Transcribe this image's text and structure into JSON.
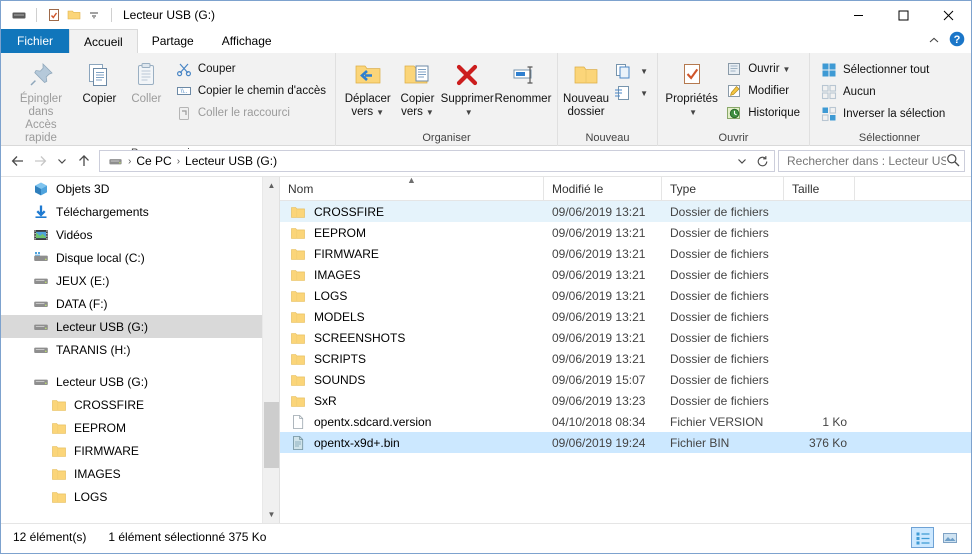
{
  "window": {
    "title": "Lecteur USB (G:)",
    "accent": "#1176bb",
    "selection_color": "#cce8ff",
    "hover_color": "#e5f3fb"
  },
  "quick_access": [
    {
      "name": "properties-qat",
      "icon": "properties-icon"
    },
    {
      "name": "new-folder-qat",
      "icon": "folder-icon"
    },
    {
      "name": "customize-qat",
      "icon": "chevron-down-icon"
    }
  ],
  "window_controls": {
    "minimize": "—",
    "maximize": "□",
    "close": "✕",
    "collapse_ribbon": "˄",
    "help": "?"
  },
  "tabs": [
    {
      "label": "Fichier",
      "kind": "file"
    },
    {
      "label": "Accueil",
      "kind": "active"
    },
    {
      "label": "Partage",
      "kind": "normal"
    },
    {
      "label": "Affichage",
      "kind": "normal"
    }
  ],
  "ribbon": {
    "groups": [
      {
        "label": "Presse-papiers",
        "big": [
          {
            "label_line1": "Épingler dans",
            "label_line2": "Accès rapide",
            "icon": "pin-icon",
            "disabled": false
          },
          {
            "label_line1": "Copier",
            "label_line2": "",
            "icon": "copy-icon",
            "disabled": false
          },
          {
            "label_line1": "Coller",
            "label_line2": "",
            "icon": "paste-icon",
            "disabled": true
          }
        ],
        "small": [
          {
            "label": "Couper",
            "icon": "scissors-icon",
            "disabled": false
          },
          {
            "label": "Copier le chemin d'accès",
            "icon": "copy-path-icon",
            "disabled": false
          },
          {
            "label": "Coller le raccourci",
            "icon": "paste-shortcut-icon",
            "disabled": true
          }
        ]
      },
      {
        "label": "Organiser",
        "big": [
          {
            "label_line1": "Déplacer",
            "label_line2": "vers",
            "icon": "move-to-icon",
            "dropdown": true
          },
          {
            "label_line1": "Copier",
            "label_line2": "vers",
            "icon": "copy-to-icon",
            "dropdown": true
          },
          {
            "label_line1": "Supprimer",
            "label_line2": "",
            "icon": "delete-icon",
            "dropdown": true
          },
          {
            "label_line1": "Renommer",
            "label_line2": "",
            "icon": "rename-icon",
            "dropdown": false
          }
        ],
        "small": []
      },
      {
        "label": "Nouveau",
        "big": [
          {
            "label_line1": "Nouveau",
            "label_line2": "dossier",
            "icon": "new-folder-icon",
            "dropdown": false
          }
        ],
        "small": [
          {
            "label": "",
            "icon": "new-item-icon",
            "dropdown": true
          },
          {
            "label": "",
            "icon": "easy-access-icon",
            "dropdown": true
          }
        ]
      },
      {
        "label": "Ouvrir",
        "big": [
          {
            "label_line1": "Propriétés",
            "label_line2": "",
            "icon": "properties-icon",
            "dropdown": true
          }
        ],
        "small": [
          {
            "label": "Ouvrir",
            "icon": "open-with-icon",
            "dropdown": true
          },
          {
            "label": "Modifier",
            "icon": "edit-icon",
            "dropdown": false
          },
          {
            "label": "Historique",
            "icon": "history-icon",
            "dropdown": false
          }
        ]
      },
      {
        "label": "Sélectionner",
        "big": [],
        "small": [
          {
            "label": "Sélectionner tout",
            "icon": "select-all-icon",
            "dropdown": false
          },
          {
            "label": "Aucun",
            "icon": "select-none-icon",
            "dropdown": false
          },
          {
            "label": "Inverser la sélection",
            "icon": "invert-selection-icon",
            "dropdown": false
          }
        ]
      }
    ]
  },
  "address": {
    "back_icon": "arrow-left-icon",
    "forward_icon": "arrow-right-icon",
    "recent_icon": "chevron-down-icon",
    "up_icon": "arrow-up-icon",
    "drive_icon": "drive-icon",
    "crumbs": [
      "Ce PC",
      "Lecteur USB (G:)"
    ],
    "separator": "›",
    "dropdown_icon": "chevron-down-icon",
    "refresh_icon": "refresh-icon"
  },
  "search": {
    "placeholder": "Rechercher dans : Lecteur US…",
    "icon": "search-icon"
  },
  "nav_tree": [
    {
      "label": "Objets 3D",
      "icon": "3d-objects-icon",
      "level": 2,
      "selected": false
    },
    {
      "label": "Téléchargements",
      "icon": "downloads-icon",
      "level": 2,
      "selected": false
    },
    {
      "label": "Vidéos",
      "icon": "videos-icon",
      "level": 2,
      "selected": false
    },
    {
      "label": "Disque local (C:)",
      "icon": "hdd-icon",
      "level": 2,
      "selected": false
    },
    {
      "label": "JEUX (E:)",
      "icon": "drive-icon",
      "level": 2,
      "selected": false
    },
    {
      "label": "DATA (F:)",
      "icon": "drive-icon",
      "level": 2,
      "selected": false
    },
    {
      "label": "Lecteur USB (G:)",
      "icon": "drive-icon",
      "level": 2,
      "selected": true
    },
    {
      "label": "TARANIS (H:)",
      "icon": "drive-icon",
      "level": 2,
      "selected": false
    },
    {
      "label": "",
      "icon": "",
      "level": 2,
      "selected": false,
      "spacer": true
    },
    {
      "label": "Lecteur USB (G:)",
      "icon": "drive-icon",
      "level": 1,
      "selected": false
    },
    {
      "label": "CROSSFIRE",
      "icon": "folder-icon",
      "level": 3,
      "selected": false
    },
    {
      "label": "EEPROM",
      "icon": "folder-icon",
      "level": 3,
      "selected": false
    },
    {
      "label": "FIRMWARE",
      "icon": "folder-icon",
      "level": 3,
      "selected": false
    },
    {
      "label": "IMAGES",
      "icon": "folder-icon",
      "level": 3,
      "selected": false
    },
    {
      "label": "LOGS",
      "icon": "folder-icon",
      "level": 3,
      "selected": false
    }
  ],
  "columns": [
    {
      "key": "name",
      "label": "Nom",
      "sorted": "asc"
    },
    {
      "key": "modified",
      "label": "Modifié le",
      "sorted": ""
    },
    {
      "key": "type",
      "label": "Type",
      "sorted": ""
    },
    {
      "key": "size",
      "label": "Taille",
      "sorted": ""
    }
  ],
  "files": [
    {
      "name": "CROSSFIRE",
      "modified": "09/06/2019 13:21",
      "type": "Dossier de fichiers",
      "size": "",
      "icon": "folder-icon",
      "state": "hover"
    },
    {
      "name": "EEPROM",
      "modified": "09/06/2019 13:21",
      "type": "Dossier de fichiers",
      "size": "",
      "icon": "folder-icon",
      "state": ""
    },
    {
      "name": "FIRMWARE",
      "modified": "09/06/2019 13:21",
      "type": "Dossier de fichiers",
      "size": "",
      "icon": "folder-icon",
      "state": ""
    },
    {
      "name": "IMAGES",
      "modified": "09/06/2019 13:21",
      "type": "Dossier de fichiers",
      "size": "",
      "icon": "folder-icon",
      "state": ""
    },
    {
      "name": "LOGS",
      "modified": "09/06/2019 13:21",
      "type": "Dossier de fichiers",
      "size": "",
      "icon": "folder-icon",
      "state": ""
    },
    {
      "name": "MODELS",
      "modified": "09/06/2019 13:21",
      "type": "Dossier de fichiers",
      "size": "",
      "icon": "folder-icon",
      "state": ""
    },
    {
      "name": "SCREENSHOTS",
      "modified": "09/06/2019 13:21",
      "type": "Dossier de fichiers",
      "size": "",
      "icon": "folder-icon",
      "state": ""
    },
    {
      "name": "SCRIPTS",
      "modified": "09/06/2019 13:21",
      "type": "Dossier de fichiers",
      "size": "",
      "icon": "folder-icon",
      "state": ""
    },
    {
      "name": "SOUNDS",
      "modified": "09/06/2019 15:07",
      "type": "Dossier de fichiers",
      "size": "",
      "icon": "folder-icon",
      "state": ""
    },
    {
      "name": "SxR",
      "modified": "09/06/2019 13:23",
      "type": "Dossier de fichiers",
      "size": "",
      "icon": "folder-icon",
      "state": ""
    },
    {
      "name": "opentx.sdcard.version",
      "modified": "04/10/2018 08:34",
      "type": "Fichier VERSION",
      "size": "1 Ko",
      "icon": "file-icon",
      "state": ""
    },
    {
      "name": "opentx-x9d+.bin",
      "modified": "09/06/2019 19:24",
      "type": "Fichier BIN",
      "size": "376 Ko",
      "icon": "bin-file-icon",
      "state": "selected"
    }
  ],
  "status": {
    "item_count": "12 élément(s)",
    "selection": "1 élément sélectionné  375 Ko",
    "views": [
      {
        "name": "details-view-button",
        "icon": "details-view-icon",
        "active": true
      },
      {
        "name": "large-icons-view-button",
        "icon": "large-icons-view-icon",
        "active": false
      }
    ]
  }
}
